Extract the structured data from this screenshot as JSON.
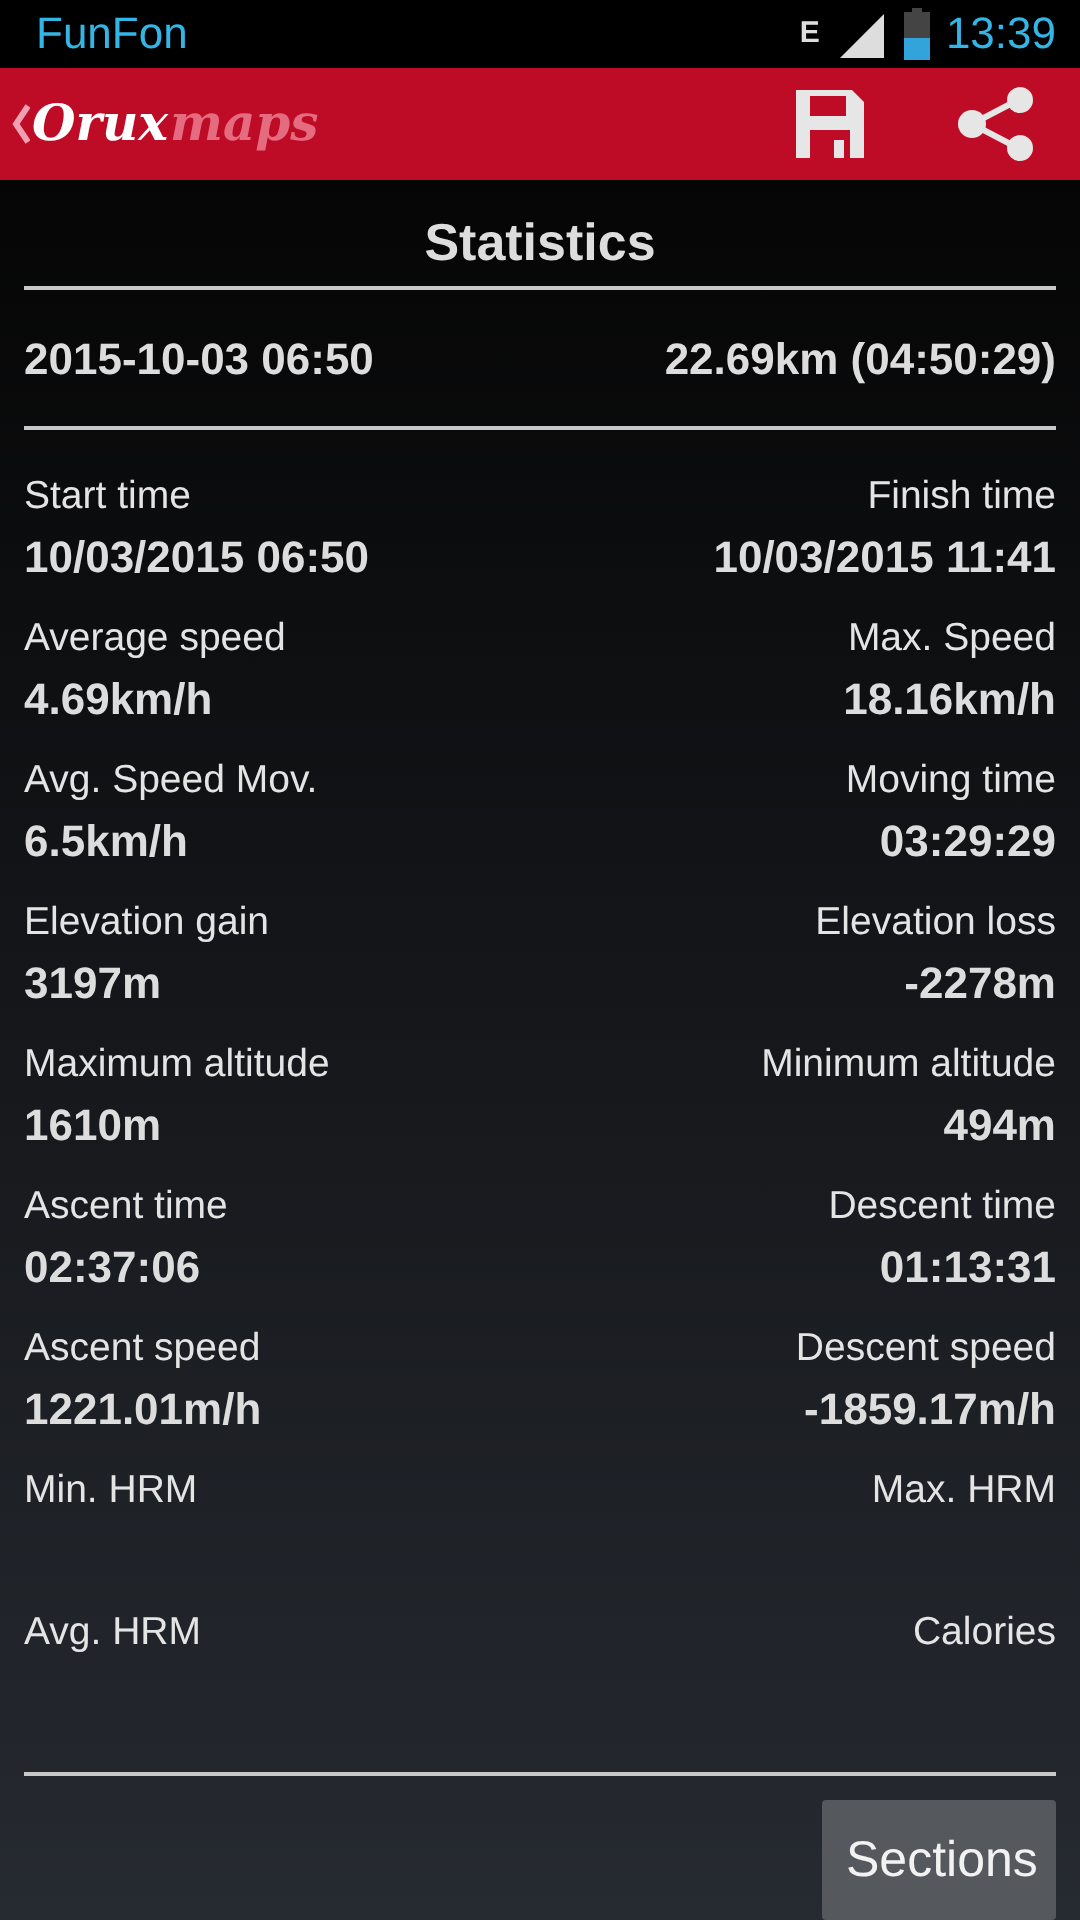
{
  "status_bar": {
    "carrier": "FunFon",
    "network": "E",
    "time": "13:39"
  },
  "app_bar": {
    "logo_bold": "Orux",
    "logo_light": "maps"
  },
  "title": "Statistics",
  "summary": {
    "date": "2015-10-03 06:50",
    "distance": "22.69km (04:50:29)"
  },
  "stats": [
    {
      "left": {
        "label": "Start time",
        "value": "10/03/2015 06:50"
      },
      "right": {
        "label": "Finish time",
        "value": "10/03/2015 11:41"
      }
    },
    {
      "left": {
        "label": "Average speed",
        "value": "4.69km/h"
      },
      "right": {
        "label": "Max. Speed",
        "value": "18.16km/h"
      }
    },
    {
      "left": {
        "label": "Avg. Speed Mov.",
        "value": "6.5km/h"
      },
      "right": {
        "label": "Moving time",
        "value": "03:29:29"
      }
    },
    {
      "left": {
        "label": "Elevation gain",
        "value": "3197m"
      },
      "right": {
        "label": "Elevation loss",
        "value": "-2278m"
      }
    },
    {
      "left": {
        "label": "Maximum altitude",
        "value": "1610m"
      },
      "right": {
        "label": "Minimum altitude",
        "value": "494m"
      }
    },
    {
      "left": {
        "label": "Ascent time",
        "value": "02:37:06"
      },
      "right": {
        "label": "Descent time",
        "value": "01:13:31"
      }
    },
    {
      "left": {
        "label": "Ascent speed",
        "value": "1221.01m/h"
      },
      "right": {
        "label": "Descent speed",
        "value": "-1859.17m/h"
      }
    },
    {
      "left": {
        "label": "Min. HRM"
      },
      "right": {
        "label": "Max. HRM"
      }
    },
    {
      "left": {
        "label": "Avg. HRM"
      },
      "right": {
        "label": "Calories"
      }
    }
  ],
  "buttons": [
    "Sections"
  ]
}
